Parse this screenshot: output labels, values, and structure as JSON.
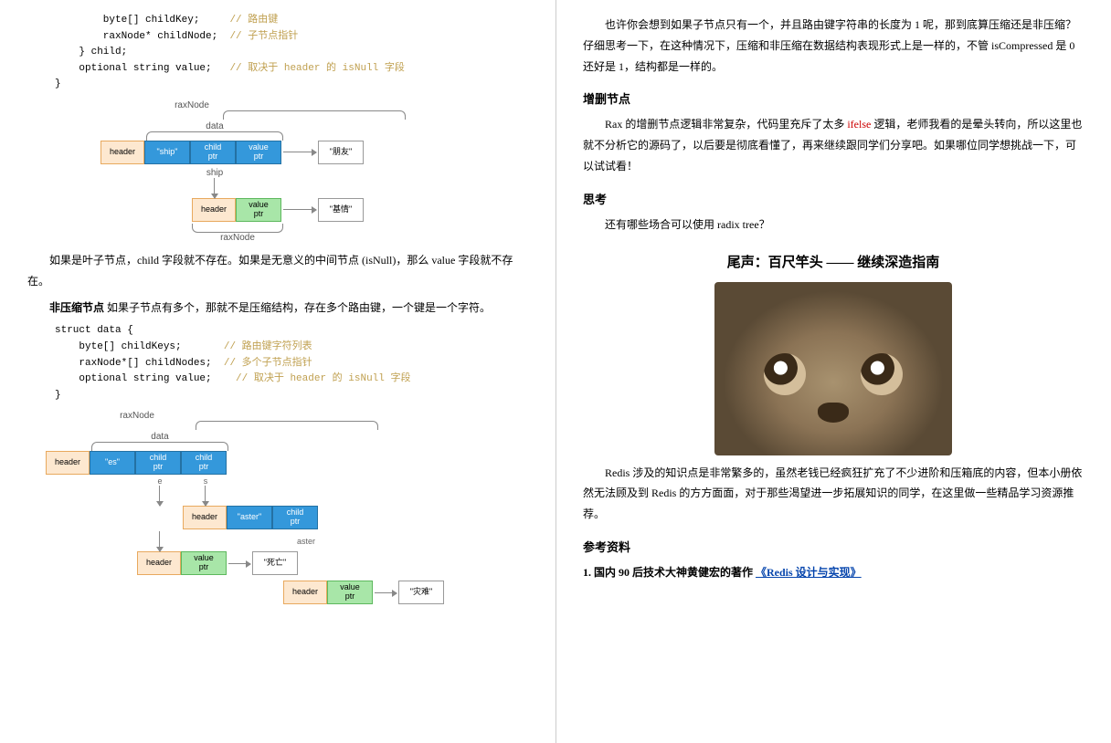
{
  "left": {
    "code1": {
      "l1a": "        byte[] childKey;     ",
      "l1b": "// 路由键",
      "l2a": "        raxNode* childNode;  ",
      "l2b": "// 子节点指针",
      "l3": "    } child;",
      "l4a": "    optional string value;   ",
      "l4b": "// 取决于 header 的 isNull 字段",
      "l5": "}"
    },
    "diag1": {
      "raxnode": "raxNode",
      "data": "data",
      "header": "header",
      "ship": "\"ship\"",
      "childptr": "child\nptr",
      "valueptr": "value\nptr",
      "friend": "\"朋友\"",
      "shipword": "ship",
      "base": "\"基情\""
    },
    "p1": "如果是叶子节点，child 字段就不存在。如果是无意义的中间节点 (isNull)，那么 value 字段就不存在。",
    "p2_lead": "非压缩节点",
    "p2": " 如果子节点有多个，那就不是压缩结构，存在多个路由键，一个键是一个字符。",
    "code2": {
      "l1": "struct data {",
      "l2a": "    byte[] childKeys;       ",
      "l2b": "// 路由键字符列表",
      "l3a": "    raxNode*[] childNodes;  ",
      "l3b": "// 多个子节点指针",
      "l4a": "    optional string value;    ",
      "l4b": "// 取决于 header 的 isNull 字段",
      "l5": "}"
    },
    "diag2": {
      "raxnode": "raxNode",
      "data": "data",
      "header": "header",
      "es": "\"es\"",
      "childptr": "child\nptr",
      "e": "e",
      "s": "s",
      "aster": "\"aster\"",
      "asterword": "aster",
      "valueptr": "value\nptr",
      "death": "\"死亡\"",
      "disaster": "\"灾难\""
    }
  },
  "right": {
    "p1": "也许你会想到如果子节点只有一个，并且路由键字符串的长度为 1 呢，那到底算压缩还是非压缩？仔细思考一下，在这种情况下，压缩和非压缩在数据结构表现形式上是一样的，不管 isCompressed 是 0 还好是 1，结构都是一样的。",
    "h_adddel": "增删节点",
    "p2a": "Rax 的增删节点逻辑非常复杂，代码里充斥了太多 ",
    "p2_ifelse": "ifelse",
    "p2b": " 逻辑，老师我看的是晕头转向，所以这里也就不分析它的源码了，以后要是彻底看懂了，再来继续跟同学们分享吧。如果哪位同学想挑战一下，可以试试看！",
    "h_think": "思考",
    "p_think": "还有哪些场合可以使用 radix tree？",
    "h_tail": "尾声：百尺竿头 —— 继续深造指南",
    "p_tail": "Redis 涉及的知识点是非常繁多的，虽然老钱已经疯狂扩充了不少进阶和压箱底的内容，但本小册依然无法顾及到 Redis 的方方面面，对于那些渴望进一步拓展知识的同学，在这里做一些精品学习资源推荐。",
    "h_ref": "参考资料",
    "ref1_num": "1.",
    "ref1_text": "国内 90 后技术大神黄健宏的著作",
    "ref1_link": "《Redis 设计与实现》"
  }
}
